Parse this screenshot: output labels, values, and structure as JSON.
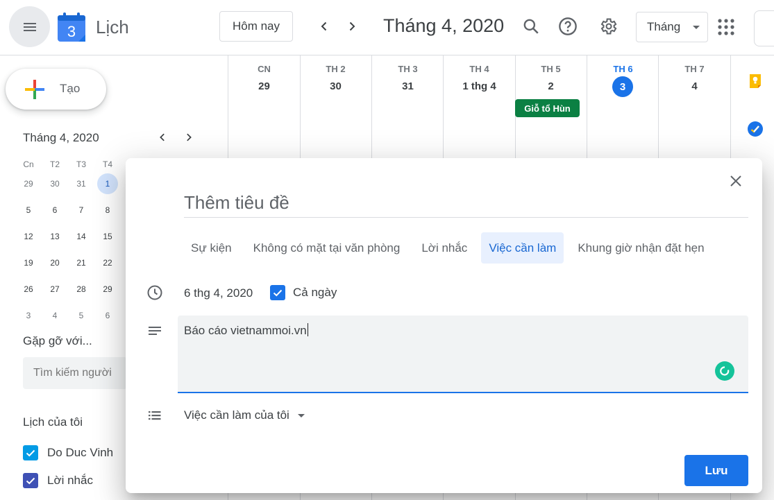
{
  "header": {
    "logo_digit": "3",
    "app_title": "Lịch",
    "today_label": "Hôm nay",
    "month_title": "Tháng 4, 2020",
    "view_label": "Tháng"
  },
  "sidebar": {
    "create_label": "Tạo",
    "mini_calendar": {
      "title": "Tháng 4, 2020",
      "weekdays": [
        "Cn",
        "T2",
        "T3",
        "T4"
      ],
      "rows": [
        [
          "29",
          "30",
          "31",
          "1"
        ],
        [
          "5",
          "6",
          "7",
          "8"
        ],
        [
          "12",
          "13",
          "14",
          "15"
        ],
        [
          "19",
          "20",
          "21",
          "22"
        ],
        [
          "26",
          "27",
          "28",
          "29"
        ],
        [
          "3",
          "4",
          "5",
          "6"
        ]
      ],
      "selected": "1"
    },
    "meet_title": "Gặp gỡ với...",
    "people_search_placeholder": "Tìm kiếm người",
    "my_calendars_title": "Lịch của tôi",
    "calendars": [
      {
        "name": "Do Duc Vinh",
        "color": "#039be5"
      },
      {
        "name": "Lời nhắc",
        "color": "#3f51b5"
      }
    ]
  },
  "week": {
    "days": [
      {
        "dow": "CN",
        "num": "29"
      },
      {
        "dow": "TH 2",
        "num": "30"
      },
      {
        "dow": "TH 3",
        "num": "31"
      },
      {
        "dow": "TH 4",
        "num": "1 thg 4"
      },
      {
        "dow": "TH 5",
        "num": "2"
      },
      {
        "dow": "TH 6",
        "num": "3"
      },
      {
        "dow": "TH 7",
        "num": "4"
      }
    ],
    "today_num": "3",
    "holiday": "Giỗ tổ Hùn"
  },
  "dialog": {
    "title_placeholder": "Thêm tiêu đề",
    "tabs": [
      {
        "label": "Sự kiện",
        "active": false
      },
      {
        "label": "Không có mặt tại văn phòng",
        "active": false
      },
      {
        "label": "Lời nhắc",
        "active": false
      },
      {
        "label": "Việc cần làm",
        "active": true
      },
      {
        "label": "Khung giờ nhận đặt hẹn",
        "active": false
      }
    ],
    "date": "6 thg 4, 2020",
    "all_day_label": "Cả ngày",
    "description": "Báo cáo vietnammoi.vn",
    "task_list": "Việc cần làm của tôi",
    "save_label": "Lưu"
  },
  "colors": {
    "accent": "#1a73e8",
    "holiday": "#0b8043"
  }
}
